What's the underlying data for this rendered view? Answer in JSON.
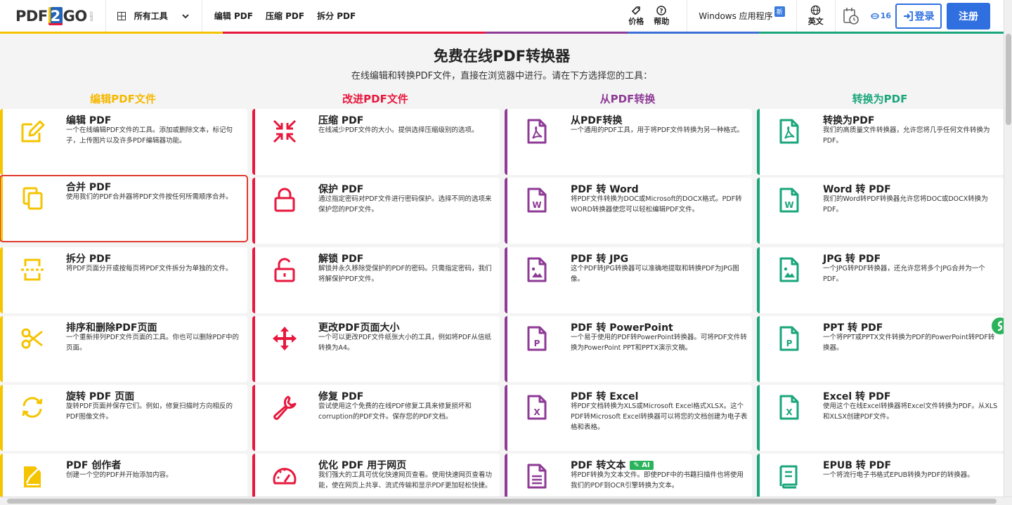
{
  "colors": {
    "accent": "#2f6fe0",
    "edit": "#f5c400",
    "improve": "#e8173d",
    "from_pdf": "#8e3a96",
    "to_pdf": "#1aa67b"
  },
  "header": {
    "logo_pdf": "PDF",
    "logo_two": "2",
    "logo_go": "GO",
    "logo_com": ".com",
    "all_tools": "所有工具",
    "nav": [
      "编辑 PDF",
      "压缩 PDF",
      "拆分 PDF"
    ],
    "pricing": "价格",
    "help": "帮助",
    "windows_app": "Windows 应用程序",
    "new_badge": "新",
    "language": "英文",
    "quota": "16",
    "login": "登录",
    "register": "注册"
  },
  "hero": {
    "title": "免费在线PDF转换器",
    "subtitle": "在线编辑和转换PDF文件，直接在浏览器中进行。请在下方选择您的工具："
  },
  "columns": [
    {
      "heading": "编辑PDF文件",
      "color": "#f5c400",
      "tools": [
        {
          "title": "编辑 PDF",
          "desc": "一个在线编辑PDF文件的工具。添加或删除文本，标记句子，上传图片以及许多PDF编辑器功能。",
          "icon": "edit-icon"
        },
        {
          "title": "合并 PDF",
          "desc": "使用我们的PDF合并器将PDF文件按任何所需顺序合并。",
          "icon": "merge-icon"
        },
        {
          "title": "拆分 PDF",
          "desc": "将PDF页面分开或按每页将PDF文件拆分为单独的文件。",
          "icon": "split-icon"
        },
        {
          "title": "排序和删除PDF页面",
          "desc": "一个重新排列PDF文件页面的工具。你也可以删除PDF中的页面。",
          "icon": "scissors-icon"
        },
        {
          "title": "旋转 PDF 页面",
          "desc": "旋转PDF页面并保存它们。例如，修复扫描时方向相反的PDF图像文件。",
          "icon": "rotate-icon"
        },
        {
          "title": "PDF 创作者",
          "desc": "创建一个空的PDF并开始添加内容。",
          "icon": "pdf-creator-icon"
        }
      ]
    },
    {
      "heading": "改进PDF文件",
      "color": "#e8173d",
      "tools": [
        {
          "title": "压缩 PDF",
          "desc": "在线减少PDF文件的大小。提供选择压缩级别的选项。",
          "icon": "compress-icon"
        },
        {
          "title": "保护 PDF",
          "desc": "通过指定密码对PDF文件进行密码保护。选择不同的选项来保护您的PDF文件。",
          "icon": "lock-icon"
        },
        {
          "title": "解锁 PDF",
          "desc": "解锁并永久移除受保护的PDF的密码。只需指定密码，我们将解保护PDF文件。",
          "icon": "unlock-icon"
        },
        {
          "title": "更改PDF页面大小",
          "desc": "一个可以更改PDF文件纸张大小的工具，例如将PDF从信纸转换为A4。",
          "icon": "move-arrows-icon"
        },
        {
          "title": "修复 PDF",
          "desc": "尝试使用这个免费的在线PDF修复工具来修复损坏和corruption的PDF文件。保存您的PDF文档。",
          "icon": "wrench-icon"
        },
        {
          "title": "优化 PDF 用于网页",
          "desc": "我们强大的工具可优化快速网页查看。使用快速网页查看功能，使在网页上共享、流式传输和显示PDF更加轻松快捷。",
          "icon": "gauge-icon"
        }
      ]
    },
    {
      "heading": "从PDF转换",
      "color": "#8e3a96",
      "tools": [
        {
          "title": "从PDF转换",
          "desc": "一个通用的PDF工具，用于将PDF文件转换为另一种格式。",
          "icon": "pdf-file-icon"
        },
        {
          "title": "PDF 转 Word",
          "desc": "将PDF文件转换为DOC或Microsoft的DOCX格式。PDF转WORD转换器使您可以轻松编辑PDF文件。",
          "icon": "word-file-icon"
        },
        {
          "title": "PDF 转 JPG",
          "desc": "这个PDF转JPG转换器可以准确地提取和转换PDF为JPG图像。",
          "icon": "image-file-icon"
        },
        {
          "title": "PDF 转 PowerPoint",
          "desc": "一个易于使用的PDF转PowerPoint转换器。可将PDF文件转换为PowerPoint PPT和PPTX演示文稿。",
          "icon": "ppt-file-icon"
        },
        {
          "title": "PDF 转 Excel",
          "desc": "将PDF文档转换为XLS或Microsoft Excel格式XLSX。这个PDF转Microsoft Excel转换器可以将您的文档创建为电子表格和表格。",
          "icon": "excel-file-icon"
        },
        {
          "title": "PDF 转文本",
          "ai": "AI",
          "desc": "将PDF转换为文本文件。即使PDF中的书籍扫描件也将使用我们的PDF到OCR引擎转换为文本。",
          "icon": "text-file-icon"
        }
      ]
    },
    {
      "heading": "转换为PDF",
      "color": "#1aa67b",
      "tools": [
        {
          "title": "转换为PDF",
          "desc": "我们的高质量文件转换器，允许您将几乎任何文件转换为PDF。",
          "icon": "pdf-file-icon"
        },
        {
          "title": "Word 转 PDF",
          "desc": "我们的Word转PDF转换器允许您将DOC或DOCX转换为PDF。",
          "icon": "word-file-icon"
        },
        {
          "title": "JPG 转 PDF",
          "desc": "一个JPG转PDF转换器，还允许您将多个JPG合并为一个PDF。",
          "icon": "image-file-icon"
        },
        {
          "title": "PPT 转 PDF",
          "desc": "一个将PPT或PPTX文件转换为PDF的PowerPoint转PDF转换器。",
          "icon": "ppt-file-icon"
        },
        {
          "title": "Excel 转 PDF",
          "desc": "使用这个在线Excel转换器将Excel文件转换为PDF。从XLS和XLSX创建PDF文件。",
          "icon": "excel-file-icon"
        },
        {
          "title": "EPUB 转 PDF",
          "desc": "一个将流行电子书格式EPUB转换为PDF的转换器。",
          "icon": "book-icon"
        }
      ]
    }
  ]
}
